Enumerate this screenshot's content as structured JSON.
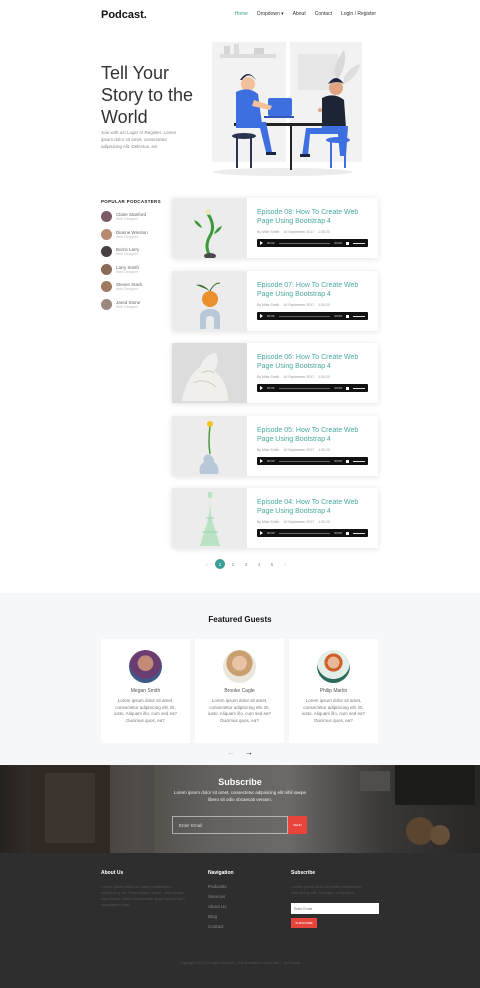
{
  "header": {
    "logo": "Podcast.",
    "nav": [
      "Home",
      "Dropdown ▾",
      "About",
      "Contact",
      "Login / Register"
    ]
  },
  "hero": {
    "title": "Tell Your Story to the World",
    "text": "Join with us! Login or Register. Lorem ipsum dolor sit amet, consectetur adipisicing elit. Delectus, ex!"
  },
  "popular": {
    "title": "POPULAR PODCASTERS",
    "items": [
      {
        "name": "Claire Stanford",
        "role": "Web Designer",
        "color": "#7b5a6a"
      },
      {
        "name": "Dianne Winston",
        "role": "Web Designer",
        "color": "#b88a72"
      },
      {
        "name": "Borris Larry",
        "role": "Web Designer",
        "color": "#4a4048"
      },
      {
        "name": "Larry Smith",
        "role": "Web Designer",
        "color": "#8a6a58"
      },
      {
        "name": "Steven Stack",
        "role": "Web Designer",
        "color": "#a07a60"
      },
      {
        "name": "Jared Stone",
        "role": "Web Designer",
        "color": "#9a8880"
      }
    ]
  },
  "episodes": [
    {
      "title": "Episode 08: How To Create Web Page Using Bootstrap 4",
      "author": "By Mike Smith",
      "date": "16 September 2017",
      "duration": "1:30:20",
      "t_start": "00:00",
      "t_end": "00:00"
    },
    {
      "title": "Episode 07: How To Create Web Page Using Bootstrap 4",
      "author": "By Mike Smith",
      "date": "16 September 2017",
      "duration": "1:30:20",
      "t_start": "00:00",
      "t_end": "00:00"
    },
    {
      "title": "Episode 06: How To Create Web Page Using Bootstrap 4",
      "author": "By Mike Smith",
      "date": "16 September 2017",
      "duration": "1:30:20",
      "t_start": "00:00",
      "t_end": "00:00"
    },
    {
      "title": "Episode 05: How To Create Web Page Using Bootstrap 4",
      "author": "By Mike Smith",
      "date": "16 September 2017",
      "duration": "1:30:20",
      "t_start": "00:00",
      "t_end": "00:00"
    },
    {
      "title": "Episode 04: How To Create Web Page Using Bootstrap 4",
      "author": "By Mike Smith",
      "date": "16 September 2017",
      "duration": "1:30:20",
      "t_start": "00:00",
      "t_end": "00:00"
    }
  ],
  "pagination": {
    "prev": "‹",
    "pages": [
      "1",
      "2",
      "3",
      "4",
      "5"
    ],
    "next": "›",
    "active": "1"
  },
  "guests": {
    "title": "Featured Guests",
    "items": [
      {
        "name": "Megan Smith",
        "text": "Lorem ipsum dolor sit amet, consectetur adipisicing elit. Et, iusto. Aliquam illo, cum sed ea? Ducimus quos, ea?"
      },
      {
        "name": "Brooke Cagle",
        "text": "Lorem ipsum dolor sit amet, consectetur adipisicing elit. Et, iusto. Aliquam illo, cum sed ea? Ducimus quos, ea?"
      },
      {
        "name": "Philip Martin",
        "text": "Lorem ipsum dolor sit amet, consectetur adipisicing elit. Et, iusto. Aliquam illo, cum sed ea? Ducimus quos, ea?"
      }
    ],
    "prev": "←",
    "next": "→"
  },
  "subscribe": {
    "title": "Subscribe",
    "text": "Lorem ipsum dolor sit amet, consectetur adipisicing elit nihil saepe libero sit odio obcaecati veniam.",
    "placeholder": "Enter Email",
    "button": "SEND"
  },
  "footer": {
    "about_title": "About Us",
    "about_text": "Lorem ipsum dolor sit amet consectetur adipisicing elit. Praesentium animi, odio beatae aspernatur natus recusandae quasi magni eum voluptatem nam.",
    "nav_title": "Navigation",
    "nav_links": [
      "Podcasts",
      "Services",
      "About Us",
      "Blog",
      "Contact"
    ],
    "sub_title": "Subscribe",
    "sub_text": "Lorem ipsum dolor sit amet consectetur adipisicing elit. Cumque, voluptates.",
    "sub_placeholder": "Enter Email",
    "sub_button": "SUBSCRIBE",
    "copyright": "Copyright ©2022 All rights reserved | This template is made with ♡ by Colorlib"
  }
}
